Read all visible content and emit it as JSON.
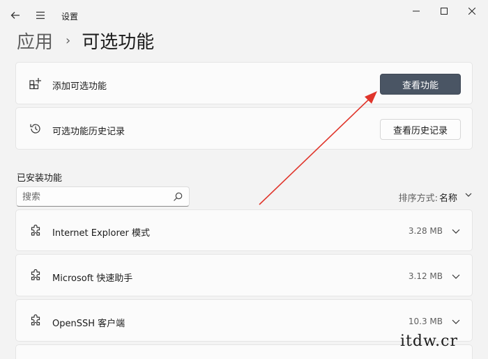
{
  "window": {
    "app_title": "设置",
    "back_icon": "back-arrow-icon",
    "menu_icon": "hamburger-menu-icon",
    "minimize_icon": "minimize-icon",
    "maximize_icon": "maximize-icon",
    "close_icon": "close-icon"
  },
  "breadcrumb": {
    "parent": "应用",
    "separator": "›",
    "current": "可选功能"
  },
  "add_feature": {
    "label": "添加可选功能",
    "button": "查看功能",
    "icon": "add-feature-grid-icon"
  },
  "history": {
    "label": "可选功能历史记录",
    "button": "查看历史记录",
    "icon": "history-clock-icon"
  },
  "installed": {
    "title": "已安装功能",
    "search_placeholder": "搜索",
    "sort_label": "排序方式:",
    "sort_value": "名称",
    "items": [
      {
        "name": "Internet Explorer 模式",
        "size": "3.28 MB",
        "icon": "puzzle-piece-icon"
      },
      {
        "name": "Microsoft 快速助手",
        "size": "3.12 MB",
        "icon": "puzzle-piece-icon"
      },
      {
        "name": "OpenSSH 客户端",
        "size": "10.3 MB",
        "icon": "puzzle-piece-icon"
      }
    ]
  },
  "watermark": "itdw.cr",
  "colors": {
    "accent_button": "#4a5564",
    "annotation_arrow": "#e0352b",
    "background": "#f3f3f3",
    "card": "#fbfbfb"
  }
}
